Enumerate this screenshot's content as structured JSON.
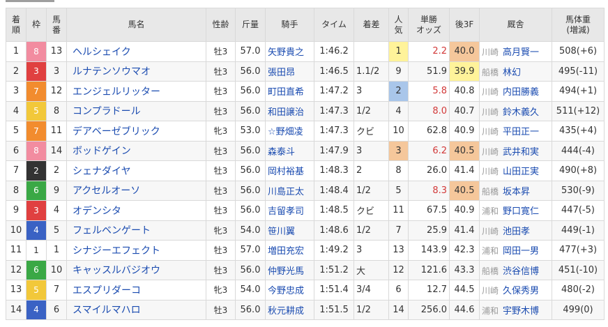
{
  "headers": [
    {
      "label": "着\n順"
    },
    {
      "label": "枠"
    },
    {
      "label": "馬\n番"
    },
    {
      "label": "馬名"
    },
    {
      "label": "性齢"
    },
    {
      "label": "斤量"
    },
    {
      "label": "騎手"
    },
    {
      "label": "タイム"
    },
    {
      "label": "着差"
    },
    {
      "label": "人\n気"
    },
    {
      "label": "単勝\nオッズ"
    },
    {
      "label": "後3F"
    },
    {
      "label": "厩舎"
    },
    {
      "label": "馬体重\n(増減)"
    }
  ],
  "waku_colors": {
    "1": {
      "bg": "#ffffff",
      "fg": "#333333"
    },
    "2": {
      "bg": "#333333",
      "fg": "#ffffff"
    },
    "3": {
      "bg": "#e04040",
      "fg": "#ffffff"
    },
    "4": {
      "bg": "#3a62c4",
      "fg": "#ffffff"
    },
    "5": {
      "bg": "#f2c83a",
      "fg": "#ffffff"
    },
    "6": {
      "bg": "#3aa845",
      "fg": "#ffffff"
    },
    "7": {
      "bg": "#f28c2e",
      "fg": "#ffffff"
    },
    "8": {
      "bg": "#f28ca0",
      "fg": "#ffffff"
    }
  },
  "rows": [
    {
      "rank": "1",
      "waku": "8",
      "num": "13",
      "horse": "ヘルシェイク",
      "sexage": "牡3",
      "weight": "57.0",
      "jockey": "矢野貴之",
      "time": "1:46.2",
      "margin": "",
      "pop": "1",
      "odds": "2.2",
      "agari": "40.0",
      "region": "川崎",
      "trainer": "高月賢一",
      "body": "508(+6)"
    },
    {
      "rank": "2",
      "waku": "3",
      "num": "3",
      "horse": "ルナテンソウマオ",
      "sexage": "牡3",
      "weight": "56.0",
      "jockey": "張田昂",
      "time": "1:46.5",
      "margin": "1.1/2",
      "pop": "9",
      "odds": "51.9",
      "agari": "39.9",
      "region": "船橋",
      "trainer": "林幻",
      "body": "495(-11)"
    },
    {
      "rank": "3",
      "waku": "7",
      "num": "12",
      "horse": "エンジェルリッター",
      "sexage": "牡3",
      "weight": "56.0",
      "jockey": "町田直希",
      "time": "1:47.2",
      "margin": "3",
      "pop": "2",
      "odds": "5.8",
      "agari": "40.8",
      "region": "川崎",
      "trainer": "内田勝義",
      "body": "494(+1)"
    },
    {
      "rank": "4",
      "waku": "5",
      "num": "8",
      "horse": "コンプラドール",
      "sexage": "牡3",
      "weight": "56.0",
      "jockey": "和田譲治",
      "time": "1:47.3",
      "margin": "1/2",
      "pop": "4",
      "odds": "8.0",
      "agari": "40.7",
      "region": "川崎",
      "trainer": "鈴木義久",
      "body": "511(+12)"
    },
    {
      "rank": "5",
      "waku": "7",
      "num": "11",
      "horse": "デアベーゼブリック",
      "sexage": "牝3",
      "weight": "53.0",
      "jockey": "☆野畑凌",
      "time": "1:47.3",
      "margin": "クビ",
      "pop": "10",
      "odds": "62.8",
      "agari": "40.9",
      "region": "川崎",
      "trainer": "平田正一",
      "body": "435(+4)"
    },
    {
      "rank": "6",
      "waku": "8",
      "num": "14",
      "horse": "ボッドゲイン",
      "sexage": "牡3",
      "weight": "56.0",
      "jockey": "森泰斗",
      "time": "1:47.9",
      "margin": "3",
      "pop": "3",
      "odds": "6.2",
      "agari": "40.5",
      "region": "川崎",
      "trainer": "武井和実",
      "body": "444(-4)"
    },
    {
      "rank": "7",
      "waku": "2",
      "num": "2",
      "horse": "シェナダイヤ",
      "sexage": "牡3",
      "weight": "56.0",
      "jockey": "岡村裕基",
      "time": "1:48.3",
      "margin": "2",
      "pop": "8",
      "odds": "26.0",
      "agari": "41.4",
      "region": "川崎",
      "trainer": "山田正実",
      "body": "490(+8)"
    },
    {
      "rank": "8",
      "waku": "6",
      "num": "9",
      "horse": "アクセルオーソ",
      "sexage": "牡3",
      "weight": "56.0",
      "jockey": "川島正太",
      "time": "1:48.4",
      "margin": "1/2",
      "pop": "5",
      "odds": "8.3",
      "agari": "40.5",
      "region": "船橋",
      "trainer": "坂本昇",
      "body": "530(-9)"
    },
    {
      "rank": "9",
      "waku": "3",
      "num": "4",
      "horse": "オデンシタ",
      "sexage": "牡3",
      "weight": "56.0",
      "jockey": "吉留孝司",
      "time": "1:48.5",
      "margin": "クビ",
      "pop": "11",
      "odds": "67.5",
      "agari": "40.9",
      "region": "浦和",
      "trainer": "野口寛仁",
      "body": "447(-5)"
    },
    {
      "rank": "10",
      "waku": "4",
      "num": "5",
      "horse": "フェルベンゲート",
      "sexage": "牝3",
      "weight": "54.0",
      "jockey": "笹川翼",
      "time": "1:48.6",
      "margin": "1/2",
      "pop": "7",
      "odds": "25.9",
      "agari": "41.4",
      "region": "川崎",
      "trainer": "池田孝",
      "body": "449(-1)"
    },
    {
      "rank": "11",
      "waku": "1",
      "num": "1",
      "horse": "シナジーエフェクト",
      "sexage": "牡3",
      "weight": "57.0",
      "jockey": "増田充宏",
      "time": "1:49.2",
      "margin": "3",
      "pop": "13",
      "odds": "143.9",
      "agari": "42.3",
      "region": "浦和",
      "trainer": "岡田一男",
      "body": "477(+3)"
    },
    {
      "rank": "12",
      "waku": "6",
      "num": "10",
      "horse": "キャッスルバジオウ",
      "sexage": "牡3",
      "weight": "56.0",
      "jockey": "仲野光馬",
      "time": "1:51.2",
      "margin": "大",
      "pop": "12",
      "odds": "121.6",
      "agari": "43.3",
      "region": "船橋",
      "trainer": "渋谷信博",
      "body": "451(-10)"
    },
    {
      "rank": "13",
      "waku": "5",
      "num": "7",
      "horse": "エスプリダーコ",
      "sexage": "牝3",
      "weight": "54.0",
      "jockey": "今野忠成",
      "time": "1:51.4",
      "margin": "3/4",
      "pop": "6",
      "odds": "12.7",
      "agari": "44.5",
      "region": "川崎",
      "trainer": "久保秀男",
      "body": "480(-2)"
    },
    {
      "rank": "14",
      "waku": "4",
      "num": "6",
      "horse": "スマイルマハロ",
      "sexage": "牡3",
      "weight": "56.0",
      "jockey": "秋元耕成",
      "time": "1:51.5",
      "margin": "1/2",
      "pop": "14",
      "odds": "256.0",
      "agari": "44.6",
      "region": "浦和",
      "trainer": "宇野木博",
      "body": "499(0)"
    }
  ]
}
